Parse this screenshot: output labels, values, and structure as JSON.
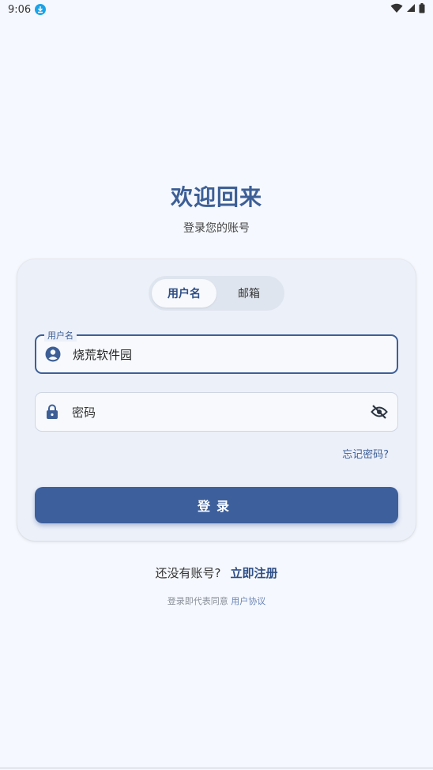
{
  "status_bar": {
    "time": "9:06",
    "icons": [
      "download-icon",
      "wifi-icon",
      "signal-icon",
      "battery-icon"
    ]
  },
  "header": {
    "title": "欢迎回来",
    "subtitle": "登录您的账号"
  },
  "login_card": {
    "tabs": [
      {
        "label": "用户名",
        "active": true
      },
      {
        "label": "邮箱",
        "active": false
      }
    ],
    "username_field": {
      "label": "用户名",
      "value": "烧荒软件园",
      "icon": "account-circle-icon"
    },
    "password_field": {
      "placeholder": "密码",
      "icon": "lock-icon",
      "toggle_icon": "eye-off-icon"
    },
    "forgot_password": "忘记密码?",
    "login_button": "登录"
  },
  "footer": {
    "no_account": "还没有账号?",
    "register_link": "立即注册",
    "agreement_prefix": "登录即代表同意",
    "agreement_link": "用户协议"
  },
  "colors": {
    "primary": "#3d5f9c",
    "background": "#f5f8fe",
    "card": "#ecf0f9"
  }
}
